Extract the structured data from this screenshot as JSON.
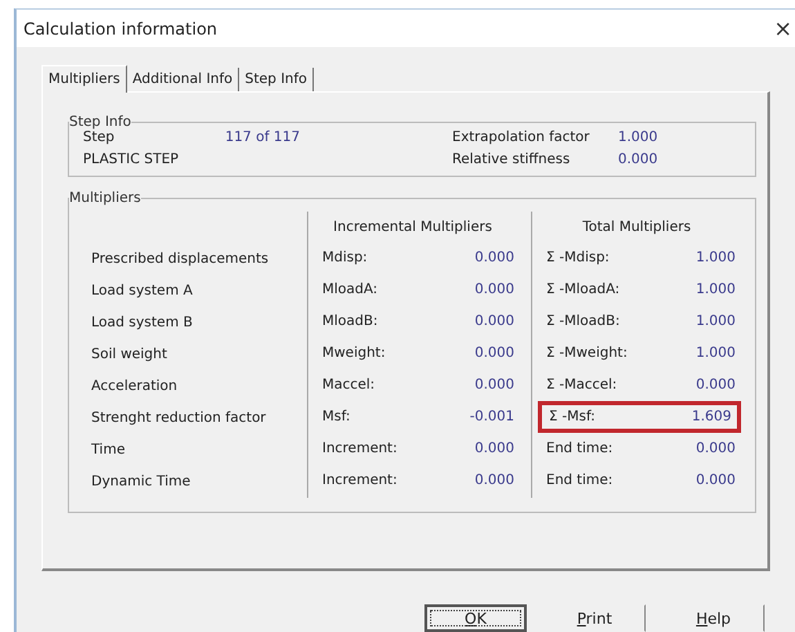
{
  "window": {
    "title": "Calculation information",
    "close": "×"
  },
  "tabs": [
    {
      "label": "Multipliers",
      "selected": true
    },
    {
      "label": "Additional Info",
      "selected": false
    },
    {
      "label": "Step Info",
      "selected": false
    }
  ],
  "step_info": {
    "title": "Step Info",
    "step_label": "Step",
    "step_value": "117 of 117",
    "phase": "PLASTIC STEP",
    "fields": [
      {
        "label": "Extrapolation factor",
        "value": "1.000"
      },
      {
        "label": "Relative stiffness",
        "value": "0.000"
      }
    ]
  },
  "multipliers": {
    "title": "Multipliers",
    "incremental_heading": "Incremental Multipliers",
    "total_heading": "Total Multipliers",
    "rows": [
      {
        "name": "Prescribed displacements",
        "inc_label": "Mdisp:",
        "inc_value": "0.000",
        "total_label": "Σ -Mdisp:",
        "total_value": "1.000",
        "highlighted": false
      },
      {
        "name": "Load system A",
        "inc_label": "MloadA:",
        "inc_value": "0.000",
        "total_label": "Σ -MloadA:",
        "total_value": "1.000",
        "highlighted": false
      },
      {
        "name": "Load system B",
        "inc_label": "MloadB:",
        "inc_value": "0.000",
        "total_label": "Σ -MloadB:",
        "total_value": "1.000",
        "highlighted": false
      },
      {
        "name": "Soil weight",
        "inc_label": "Mweight:",
        "inc_value": "0.000",
        "total_label": "Σ -Mweight:",
        "total_value": "1.000",
        "highlighted": false
      },
      {
        "name": "Acceleration",
        "inc_label": "Maccel:",
        "inc_value": "0.000",
        "total_label": "Σ -Maccel:",
        "total_value": "0.000",
        "highlighted": false
      },
      {
        "name": "Strenght reduction factor",
        "inc_label": "Msf:",
        "inc_value": "-0.001",
        "total_label": "Σ -Msf:",
        "total_value": "1.609",
        "highlighted": true
      },
      {
        "name": "Time",
        "inc_label": "Increment:",
        "inc_value": "0.000",
        "total_label": "End time:",
        "total_value": "0.000",
        "highlighted": false
      },
      {
        "name": "Dynamic Time",
        "inc_label": "Increment:",
        "inc_value": "0.000",
        "total_label": "End time:",
        "total_value": "0.000",
        "highlighted": false
      }
    ]
  },
  "buttons": [
    {
      "access_key": "O",
      "rest": "K",
      "default": true
    },
    {
      "access_key": "P",
      "rest": "rint",
      "default": false
    },
    {
      "access_key": "H",
      "rest": "elp",
      "default": false
    }
  ]
}
